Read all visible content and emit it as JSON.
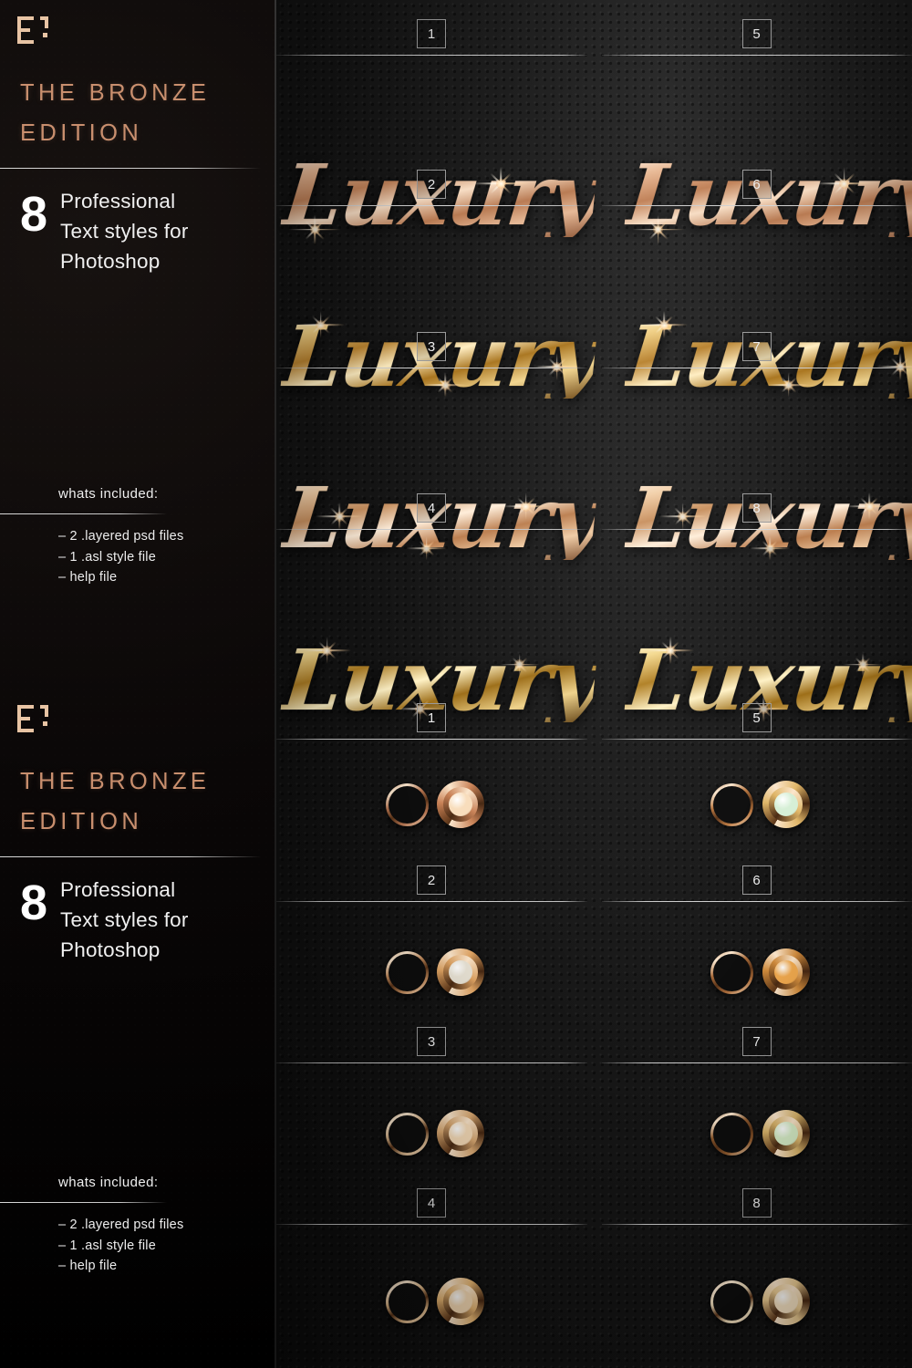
{
  "sidebar": {
    "logo_icon": "e-bracket-logo-icon",
    "brand_title": "THE BRONZE\nEDITION",
    "count_number": "8",
    "count_text": "Professional\nText styles for\nPhotoshop",
    "included_title": "whats included:",
    "included_list": "– 2 .layered psd files\n– 1 .asl style file\n– help file",
    "accent_color": "#c98f6e",
    "panels": [
      "panel-top",
      "panel-bottom"
    ]
  },
  "showcase": {
    "word": "Luxury",
    "text_styles": [
      {
        "num": "1",
        "tone": "rose-gold",
        "color": "#e8b894"
      },
      {
        "num": "2",
        "tone": "bright-gold",
        "color": "#f0cf84"
      },
      {
        "num": "3",
        "tone": "light-rose-gold",
        "color": "#f2cfa8"
      },
      {
        "num": "4",
        "tone": "deep-gold",
        "color": "#f4d98f"
      },
      {
        "num": "5",
        "tone": "rose-gold",
        "color": "#e8b894"
      },
      {
        "num": "6",
        "tone": "bright-gold",
        "color": "#f0cf84"
      },
      {
        "num": "7",
        "tone": "light-rose-gold",
        "color": "#f2cfa8"
      },
      {
        "num": "8",
        "tone": "deep-gold",
        "color": "#f4d98f"
      }
    ],
    "circle_styles": [
      {
        "num": "1",
        "ring": "#b57450",
        "disc_center": "#f8ddbc",
        "disc_rim": "#c98257"
      },
      {
        "num": "2",
        "ring": "#c08a5c",
        "disc_center": "#e8e2d4",
        "disc_rim": "#e0a463"
      },
      {
        "num": "3",
        "ring": "#d8b48a",
        "disc_center": "#f7dcb8",
        "disc_rim": "#d9a871"
      },
      {
        "num": "4",
        "ring": "#e0b887",
        "disc_center": "#f4d8b2",
        "disc_rim": "#e5b471"
      },
      {
        "num": "5",
        "ring": "#b8763f",
        "disc_center": "#d6efd6",
        "disc_rim": "#e0b668"
      },
      {
        "num": "6",
        "ring": "#a86b3a",
        "disc_center": "#f0a94e",
        "disc_rim": "#d08b3c"
      },
      {
        "num": "7",
        "ring": "#8e5a2e",
        "disc_center": "#d8efc8",
        "disc_rim": "#d9b46a"
      },
      {
        "num": "8",
        "ring": "#e8d6b4",
        "disc_center": "#f6e2c2",
        "disc_rim": "#e9c98f"
      }
    ]
  }
}
